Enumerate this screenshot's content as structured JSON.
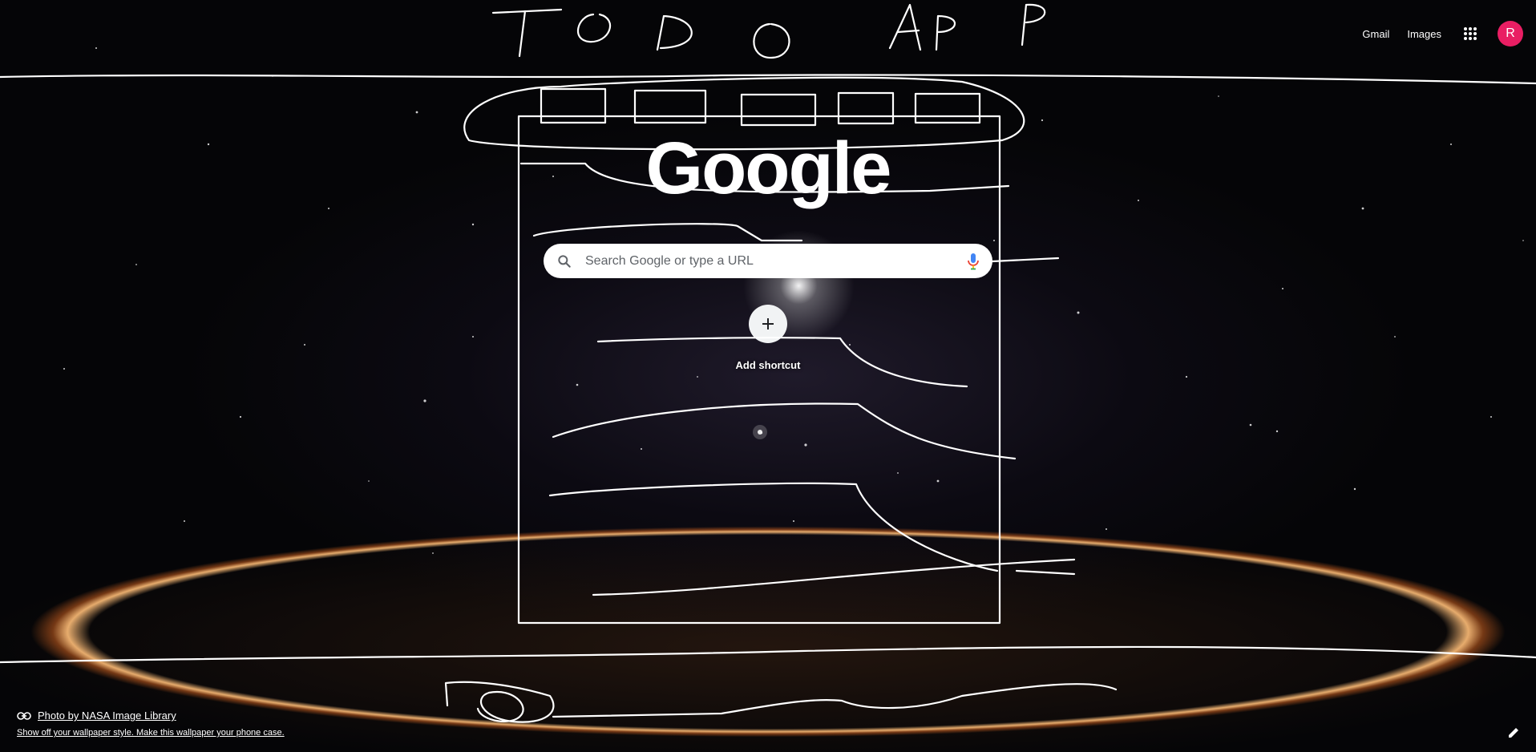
{
  "header": {
    "gmail_label": "Gmail",
    "images_label": "Images",
    "avatar_initial": "R",
    "avatar_color": "#e91e63"
  },
  "logo": {
    "text": "Google"
  },
  "search": {
    "placeholder": "Search Google or type a URL",
    "value": ""
  },
  "shortcuts": {
    "add_label": "Add shortcut"
  },
  "attribution": {
    "photo_credit": "Photo by NASA Image Library",
    "wallpaper_note": "Show off your wallpaper style. Make this wallpaper your phone case."
  },
  "icons": {
    "apps": "grid-icon",
    "search": "search-icon",
    "mic": "mic-icon",
    "add": "plus-icon",
    "link": "link-icon",
    "customize": "pencil-icon"
  }
}
